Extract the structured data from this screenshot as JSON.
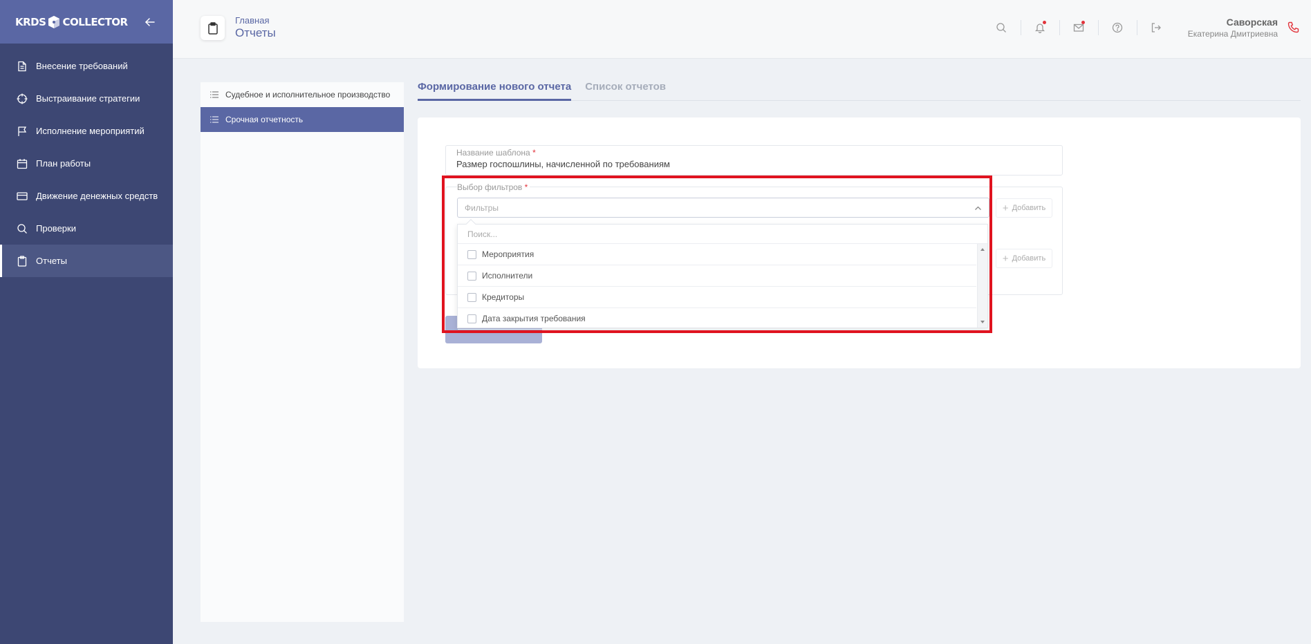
{
  "sidebar": {
    "logo_left": "KRDS",
    "logo_right": "COLLECTOR",
    "items": [
      {
        "label": "Внесение требований",
        "icon": "document-icon"
      },
      {
        "label": "Выстраивание стратегии",
        "icon": "crosshair-icon"
      },
      {
        "label": "Исполнение мероприятий",
        "icon": "flag-icon"
      },
      {
        "label": "План работы",
        "icon": "calendar-icon"
      },
      {
        "label": "Движение денежных средств",
        "icon": "card-icon"
      },
      {
        "label": "Проверки",
        "icon": "search-icon"
      },
      {
        "label": "Отчеты",
        "icon": "clipboard-icon",
        "active": true
      }
    ]
  },
  "header": {
    "breadcrumb": "Главная",
    "title": "Отчеты",
    "user_last_name": "Саворская",
    "user_first_names": "Екатерина Дмитриевна"
  },
  "report_list": {
    "items": [
      {
        "label": "Судебное и исполнительное производство",
        "active": false
      },
      {
        "label": "Срочная отчетность",
        "active": true
      }
    ]
  },
  "tabs": [
    {
      "label": "Формирование нового отчета",
      "active": true
    },
    {
      "label": "Список отчетов",
      "active": false
    }
  ],
  "form": {
    "template_label": "Название шаблона",
    "required_mark": "*",
    "template_value": "Размер госпошлины, начисленной по требованиям",
    "filters_label": "Выбор фильтров",
    "filters_placeholder": "Фильтры",
    "add_label": "Добавить",
    "search_placeholder": "Поиск...",
    "options": [
      "Мероприятия",
      "Исполнители",
      "Кредиторы",
      "Дата закрытия требования"
    ]
  },
  "colors": {
    "sidebar_bg": "#3d4773",
    "accent": "#5a67a4",
    "highlight": "#e0131f",
    "notification_dot": "#e2333b"
  }
}
